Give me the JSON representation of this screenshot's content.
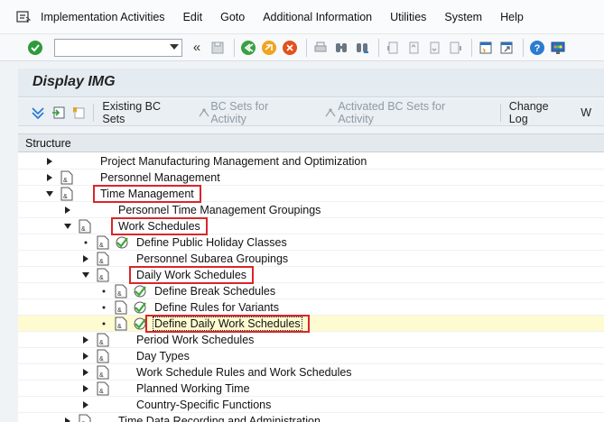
{
  "menu": {
    "items": [
      "Implementation Activities",
      "Edit",
      "Goto",
      "Additional Information",
      "Utilities",
      "System",
      "Help"
    ]
  },
  "toolbar": {
    "command_value": "",
    "back_glyph": "«"
  },
  "title": "Display IMG",
  "app_toolbar": {
    "existing_bc_sets": "Existing BC Sets",
    "bc_sets_activity": "BC Sets for Activity",
    "activated_bc_sets": "Activated BC Sets for Activity",
    "change_log": "Change Log",
    "overflow": "W"
  },
  "tree": {
    "header": "Structure",
    "rows": [
      {
        "label": "Project Manufacturing Management and Optimization"
      },
      {
        "label": "Personnel Management"
      },
      {
        "label": "Time Management"
      },
      {
        "label": "Personnel Time Management Groupings"
      },
      {
        "label": "Work Schedules"
      },
      {
        "label": "Define Public Holiday Classes"
      },
      {
        "label": "Personnel Subarea Groupings"
      },
      {
        "label": "Daily Work Schedules"
      },
      {
        "label": "Define Break Schedules"
      },
      {
        "label": "Define Rules for Variants"
      },
      {
        "label": "Define Daily Work Schedules"
      },
      {
        "label": "Period Work Schedules"
      },
      {
        "label": "Day Types"
      },
      {
        "label": "Work Schedule Rules and Work Schedules"
      },
      {
        "label": "Planned Working Time"
      },
      {
        "label": "Country-Specific Functions"
      },
      {
        "label": "Time Data Recording and Administration"
      }
    ]
  },
  "colors": {
    "highlight_box": "#d9262b",
    "selected_row": "#fffbd0",
    "status_green": "#3aa935"
  }
}
